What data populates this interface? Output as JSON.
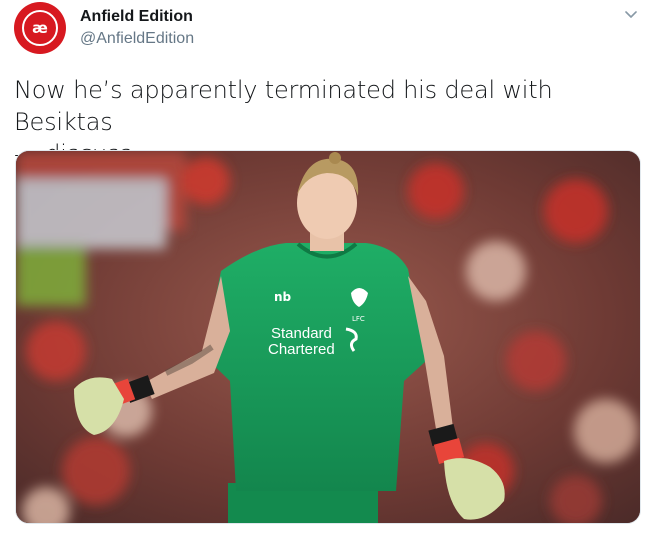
{
  "tweet": {
    "author_name": "Anfield Edition",
    "author_handle": "@AnfieldEdition",
    "avatar_initials": "æ",
    "text_line1": "Now he’s apparently terminated his deal with Besiktas",
    "text_line2": "— discuss.",
    "photo": {
      "kit_sponsor_line1": "Standard",
      "kit_sponsor_line2": "Chartered",
      "crest_text": "LFC"
    }
  },
  "colors": {
    "brand_red": "#d71920",
    "kit_green": "#1e9a5a",
    "handle_gray": "#657786"
  },
  "icons": {
    "menu": "chevron-down-icon"
  }
}
